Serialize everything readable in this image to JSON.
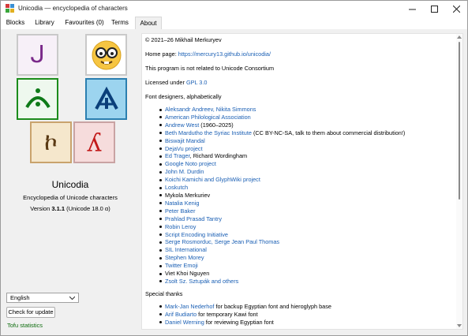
{
  "window": {
    "title": "Unicodia — encyclopedia of characters"
  },
  "tabs": [
    {
      "label": "Blocks"
    },
    {
      "label": "Library"
    },
    {
      "label": "Favourites (0)"
    },
    {
      "label": "Terms"
    },
    {
      "label": "About",
      "active": true
    }
  ],
  "tiles": [
    {
      "glyph": "ᒍ",
      "icon": "canadian-syllabics-tile",
      "color": "#7a2a8a",
      "border": "#c8a0d0"
    },
    {
      "glyph": "",
      "icon": "nerd-face-emoji-tile",
      "color": "#000000",
      "border": "#c9c9c9"
    },
    {
      "glyph": "ᨗ",
      "icon": "green-script-tile",
      "color": "#0e7a18",
      "border": "#1c8c1c"
    },
    {
      "glyph": "ᕱ",
      "icon": "blue-script-tile",
      "color": "#0a3f7a",
      "border": "#2b7fb0"
    },
    {
      "glyph": "ኮ",
      "icon": "ethiopic-tile",
      "color": "#5a3a14",
      "border": "#c9a36d"
    },
    {
      "glyph": "ʎ",
      "icon": "red-letter-tile",
      "color": "#c21a1a",
      "border": "#c9a3a3"
    }
  ],
  "app": {
    "name": "Unicodia",
    "subtitle": "Encyclopedia of Unicode characters",
    "version_prefix": "Version ",
    "version": "3.1.1",
    "version_suffix": " (Unicode 18.0 α)"
  },
  "language": {
    "selected": "English"
  },
  "buttons": {
    "check_update": "Check for update"
  },
  "tofu_link": "Tofu statistics",
  "about": {
    "copyright": "© 2021–26 Mikhail Merkuryev",
    "homepage_label": "Home page: ",
    "homepage_url": "https://mercury13.github.io/unicodia/",
    "not_related": "This program is not related to Unicode Consortium",
    "licensed_label": "Licensed under ",
    "license": "GPL 3.0",
    "font_designers_heading": "Font designers, alphabetically",
    "font_designers": [
      {
        "link": "Aleksandr Andreev, Nikita Simmons",
        "rest": ""
      },
      {
        "link": "American Philological Association",
        "rest": ""
      },
      {
        "link": "Andrew West",
        "rest": " (1960–2025)"
      },
      {
        "link": "Beth Mardutho the Syriac Institute",
        "rest": " (CC BY-NC-SA, talk to them about commercial distribution!)"
      },
      {
        "link": "Biswajit Mandal",
        "rest": ""
      },
      {
        "link": "DejaVu project",
        "rest": ""
      },
      {
        "link": "Ed Trager",
        "rest": ", Richard Wordingham"
      },
      {
        "link": "Google Noto project",
        "rest": ""
      },
      {
        "link": "John M. Durdin",
        "rest": ""
      },
      {
        "link": "Koichi Kamichi and GlyphWiki project",
        "rest": ""
      },
      {
        "link": "Loskutch",
        "rest": ""
      },
      {
        "link": "",
        "rest": "Mykola Merkuriev"
      },
      {
        "link": "Natalia Kenig",
        "rest": ""
      },
      {
        "link": "Peter Baker",
        "rest": ""
      },
      {
        "link": "Prahlad Prasad Tantry",
        "rest": ""
      },
      {
        "link": "Robin Leroy",
        "rest": ""
      },
      {
        "link": "Script Encoding Initiative",
        "rest": ""
      },
      {
        "link": "Serge Rosmorduc, Serge Jean Paul Thomas",
        "rest": ""
      },
      {
        "link": "SIL International",
        "rest": ""
      },
      {
        "link": "Stephen Morey",
        "rest": ""
      },
      {
        "link": "Twitter Emoji",
        "rest": ""
      },
      {
        "link": "",
        "rest": "Viet Khoi Nguyen"
      },
      {
        "link": "Zsolt Sz. Sztupák and others",
        "rest": ""
      }
    ],
    "thanks_heading": "Special thanks",
    "thanks": [
      {
        "link": "Mark-Jan Nederhof",
        "rest": " for backup Egyptian font and hieroglyph base"
      },
      {
        "link": "Arif Budiarto",
        "rest": " for temporary Kawi font"
      },
      {
        "link": "Daniel Werning",
        "rest": " for reviewing Egyptian font"
      }
    ]
  }
}
